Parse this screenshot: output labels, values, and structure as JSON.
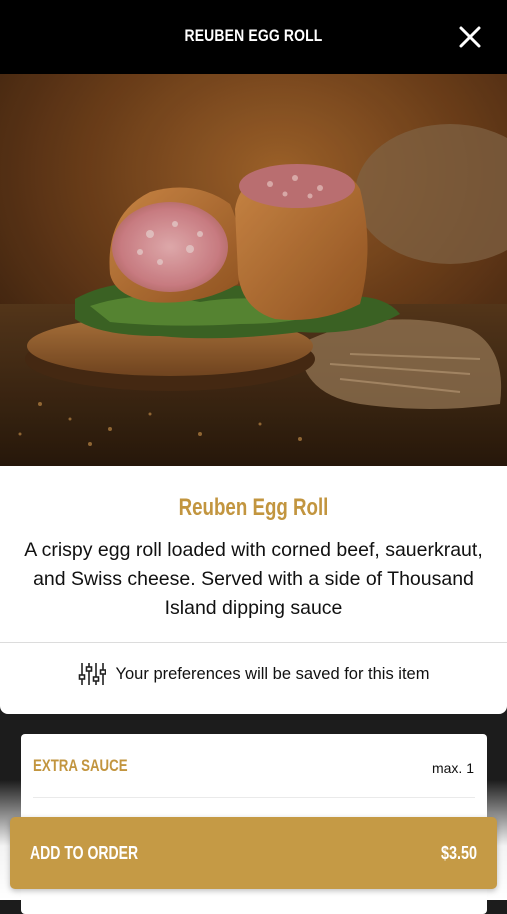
{
  "header": {
    "title": "REUBEN EGG ROLL",
    "close_icon": "close-icon"
  },
  "item": {
    "name": "Reuben Egg Roll",
    "description": "A crispy egg roll loaded with corned beef, sauerkraut, and Swiss cheese. Served with a side of Thousand Island dipping sauce",
    "preferences_note": "Your preferences will be saved for this item",
    "preferences_icon": "sliders-icon"
  },
  "options": {
    "group_label": "EXTRA SAUCE",
    "max_label": "max. 1"
  },
  "cta": {
    "label": "ADD TO ORDER",
    "price": "$3.50"
  },
  "colors": {
    "accent": "#c59a45",
    "title_gold": "#c2953f",
    "header_bg": "#000000"
  }
}
